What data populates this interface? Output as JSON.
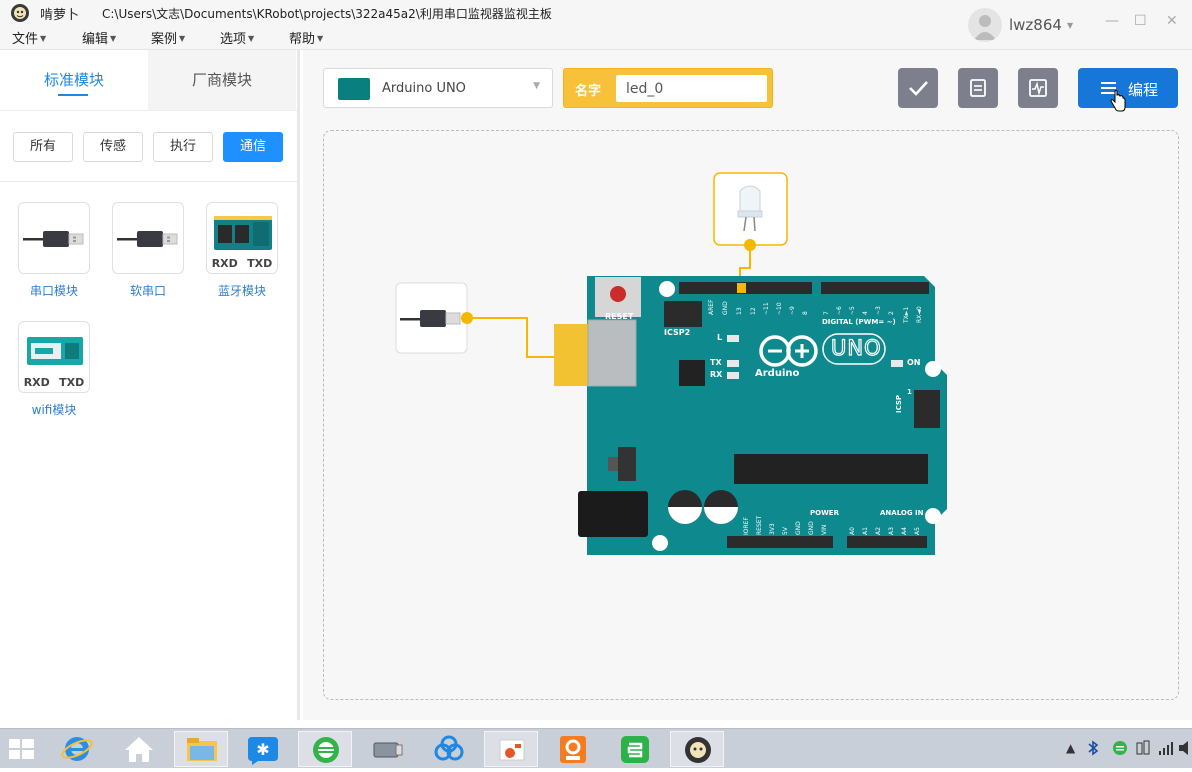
{
  "titlebar": {
    "app_name": "啃萝卜",
    "file_path": "C:\\Users\\文志\\Documents\\KRobot\\projects\\322a45a2\\利用串口监视器监视主板"
  },
  "menu": [
    {
      "label": "文件"
    },
    {
      "label": "编辑"
    },
    {
      "label": "案例"
    },
    {
      "label": "选项"
    },
    {
      "label": "帮助"
    }
  ],
  "user": {
    "name": "lwz864"
  },
  "window_controls": {
    "minimize": "—",
    "maximize": "☐",
    "close": "✕"
  },
  "sidebar": {
    "tabs": [
      {
        "label": "标准模块",
        "active": true
      },
      {
        "label": "厂商模块",
        "active": false
      }
    ],
    "filters": [
      {
        "label": "所有",
        "active": false
      },
      {
        "label": "传感",
        "active": false
      },
      {
        "label": "执行",
        "active": false
      },
      {
        "label": "通信",
        "active": true
      }
    ],
    "modules": [
      {
        "label": "串口模块",
        "icon": "usb-plug-icon"
      },
      {
        "label": "软串口",
        "icon": "usb-plug-icon"
      },
      {
        "label": "蓝牙模块",
        "icon": "bluetooth-board-icon",
        "pins": [
          "RXD",
          "TXD"
        ]
      },
      {
        "label": "wifi模块",
        "icon": "wifi-board-icon",
        "pins": [
          "RXD",
          "TXD"
        ]
      }
    ]
  },
  "toolbar": {
    "board": "Arduino UNO",
    "name_label": "名字",
    "name_value": "led_0",
    "program_label": "编程"
  },
  "board": {
    "reset_label": "RESET",
    "icsp2_label": "ICSP2",
    "icsp_label": "ICSP",
    "digital_label": "DIGITAL (PWM= ~)",
    "brand": "Arduino",
    "model": "UNO",
    "led_labels": [
      "L",
      "TX",
      "RX"
    ],
    "on_label": "ON",
    "power_label": "POWER",
    "analog_label": "ANALOG IN",
    "top_pin_labels": [
      "AREF",
      "GND",
      "13",
      "12",
      "~11",
      "~10",
      "~9",
      "8",
      "7",
      "~6",
      "~5",
      "4",
      "~3",
      "2",
      "TX►1",
      "RX◄0"
    ],
    "power_pin_labels": [
      "IOREF",
      "RESET",
      "3V3",
      "5V",
      "GND",
      "GND",
      "VIN"
    ],
    "analog_pin_labels": [
      "A0",
      "A1",
      "A2",
      "A3",
      "A4",
      "A5"
    ],
    "icsp_pin_one": "1"
  },
  "colors": {
    "accent": "#1e88e5",
    "board": "#0e8a8e",
    "wire": "#f5b800",
    "name_box": "#f8c13a"
  },
  "taskbar": {
    "apps": [
      "start-icon",
      "ie-icon",
      "home-icon",
      "folder-icon",
      "star-app-icon",
      "green-sync-icon",
      "usb-app-icon",
      "cloud-icon",
      "office-icon",
      "pdf-icon",
      "wps-icon",
      "krobot-icon"
    ]
  }
}
